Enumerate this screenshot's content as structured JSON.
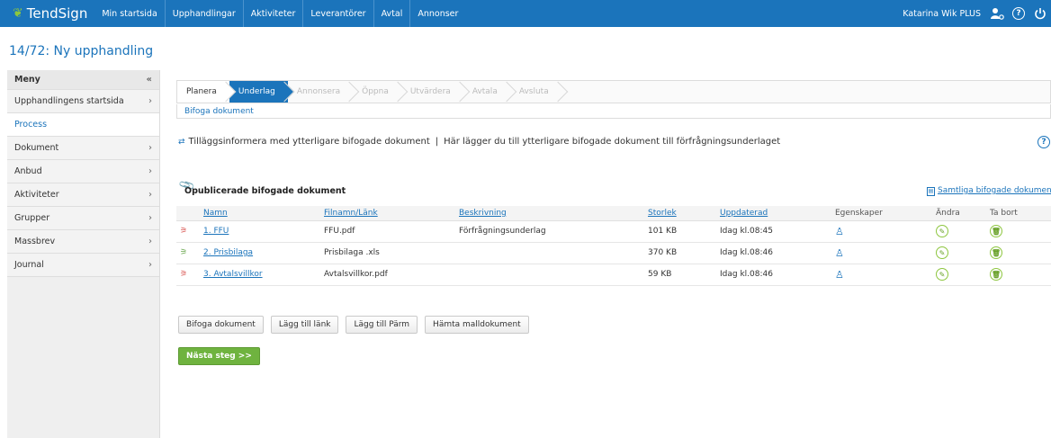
{
  "topbar": {
    "brand": "TendSign",
    "nav": [
      "Min startsida",
      "Upphandlingar",
      "Aktiviteter",
      "Leverantörer",
      "Avtal",
      "Annonser"
    ],
    "user": "Katarina Wik PLUS",
    "help_glyph": "?",
    "colors": {
      "bar": "#1b74bb",
      "brand_leaf": "#8dc63f"
    }
  },
  "page_title": "14/72: Ny upphandling",
  "sidebar": {
    "header": "Meny",
    "collapse_glyph": "«",
    "items": [
      {
        "label": "Upphandlingens startsida",
        "chevron": true
      },
      {
        "label": "Process",
        "chevron": false,
        "active": true
      },
      {
        "label": "Dokument",
        "chevron": true
      },
      {
        "label": "Anbud",
        "chevron": true
      },
      {
        "label": "Aktiviteter",
        "chevron": true
      },
      {
        "label": "Grupper",
        "chevron": true
      },
      {
        "label": "Massbrev",
        "chevron": true
      },
      {
        "label": "Journal",
        "chevron": true
      }
    ]
  },
  "process_steps": [
    {
      "label": "Planera",
      "state": "done"
    },
    {
      "label": "Underlag",
      "state": "current"
    },
    {
      "label": "Annonsera",
      "state": "pending"
    },
    {
      "label": "Öppna",
      "state": "pending"
    },
    {
      "label": "Utvärdera",
      "state": "pending"
    },
    {
      "label": "Avtala",
      "state": "pending"
    },
    {
      "label": "Avsluta",
      "state": "pending"
    }
  ],
  "subtab": "Bifoga dokument",
  "info": {
    "title": "Tilläggsinformera med ytterligare bifogade dokument",
    "separator": "|",
    "description": "Här lägger du till ytterligare bifogade dokument till förfrågningsunderlaget"
  },
  "section": {
    "title": "Opublicerade bifogade dokument",
    "all_docs_link": "Samtliga bifogade dokument"
  },
  "table": {
    "headers": [
      "Namn",
      "Filnamn/Länk",
      "Beskrivning",
      "Storlek",
      "Uppdaterad",
      "Egenskaper",
      "Ändra",
      "Ta bort"
    ],
    "rows": [
      {
        "type": "pdf",
        "name": "1. FFU",
        "file": "FFU.pdf",
        "description": "Förfrågningsunderlag",
        "size": "101 KB",
        "updated": "Idag kl.08:45"
      },
      {
        "type": "xls",
        "name": "2. Prisbilaga",
        "file": "Prisbilaga .xls",
        "description": "",
        "size": "370 KB",
        "updated": "Idag kl.08:46"
      },
      {
        "type": "pdf",
        "name": "3. Avtalsvillkor",
        "file": "Avtalsvillkor.pdf",
        "description": "",
        "size": "59 KB",
        "updated": "Idag kl.08:46"
      }
    ]
  },
  "buttons": {
    "attach": "Bifoga dokument",
    "add_link": "Lägg till länk",
    "add_binder": "Lägg till Pärm",
    "template": "Hämta malldokument",
    "next": "Nästa steg >>"
  }
}
